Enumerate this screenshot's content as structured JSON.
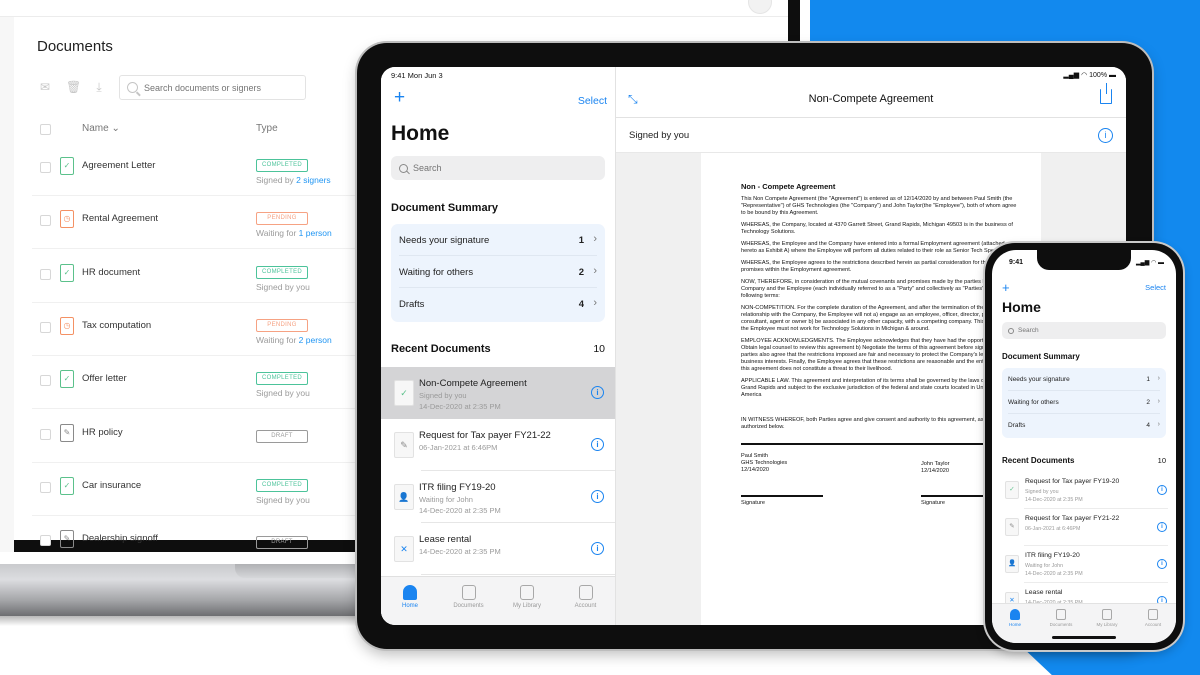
{
  "colors": {
    "brand_blue": "#1289ee",
    "accent_blue": "#1a84f0",
    "completed": "#4cc39a",
    "pending": "#f6a283",
    "draft": "#9a9a9a",
    "summary_bg": "#edf4fd"
  },
  "laptop": {
    "page_title": "Documents",
    "toolbar_icons": [
      "mail-icon",
      "trash-icon",
      "download-icon"
    ],
    "search": {
      "placeholder": "Search documents or signers",
      "value": ""
    },
    "columns": {
      "name": "Name",
      "type": "Type"
    },
    "rows": [
      {
        "name": "Agreement Letter",
        "status": "completed",
        "badge": "COMPLETED",
        "sub_prefix": "Signed by ",
        "sub_link": "2 signers"
      },
      {
        "name": "Rental Agreement",
        "status": "pending",
        "badge": "PENDING",
        "sub_prefix": "Waiting for ",
        "sub_link": "1 person"
      },
      {
        "name": "HR document",
        "status": "completed",
        "badge": "COMPLETED",
        "sub_prefix": "Signed by you",
        "sub_link": ""
      },
      {
        "name": "Tax computation",
        "status": "pending",
        "badge": "PENDING",
        "sub_prefix": "Waiting for ",
        "sub_link": "2 person"
      },
      {
        "name": "Offer letter",
        "status": "completed",
        "badge": "COMPLETED",
        "sub_prefix": "Signed by you",
        "sub_link": ""
      },
      {
        "name": "HR policy",
        "status": "draft",
        "badge": "DRAFT",
        "sub_prefix": "",
        "sub_link": ""
      },
      {
        "name": "Car insurance",
        "status": "completed",
        "badge": "COMPLETED",
        "sub_prefix": "Signed by you",
        "sub_link": ""
      },
      {
        "name": "Dealership signoff",
        "status": "draft",
        "badge": "DRAFT",
        "sub_prefix": "",
        "sub_link": ""
      }
    ]
  },
  "ipad": {
    "status_time": "9:41 Mon Jun 3",
    "status_right": "100%",
    "select_label": "Select",
    "home_title": "Home",
    "search_placeholder": "Search",
    "summary_title": "Document Summary",
    "summary": [
      {
        "label": "Needs your signature",
        "count": "1"
      },
      {
        "label": "Waiting for others",
        "count": "2"
      },
      {
        "label": "Drafts",
        "count": "4"
      }
    ],
    "recent_title": "Recent Documents",
    "recent_count": "10",
    "recent": [
      {
        "title": "Non-Compete Agreement",
        "line1": "Signed by you",
        "line2": "14-Dec-2020 at 2:35 PM",
        "icon": "check-icon",
        "selected": true
      },
      {
        "title": "Request for Tax payer FY21-22",
        "line1": "06-Jan-2021 at 6:46PM",
        "line2": "",
        "icon": "pencil-icon",
        "selected": false
      },
      {
        "title": "ITR filing FY19-20",
        "line1": "Waiting for John",
        "line2": "14-Dec-2020 at 2:35 PM",
        "icon": "person-icon",
        "selected": false
      },
      {
        "title": "Lease rental",
        "line1": "14-Dec-2020 at 2:35 PM",
        "line2": "",
        "icon": "signature-icon",
        "selected": false
      }
    ],
    "tabs": [
      {
        "label": "Home",
        "icon": "home-icon",
        "active": true
      },
      {
        "label": "Documents",
        "icon": "document-icon",
        "active": false
      },
      {
        "label": "My Library",
        "icon": "library-icon",
        "active": false
      },
      {
        "label": "Account",
        "icon": "account-icon",
        "active": false
      }
    ],
    "viewer": {
      "title": "Non-Compete Agreement",
      "signed_status": "Signed by you",
      "doc_heading": "Non - Compete Agreement",
      "paragraphs": [
        "This Non Compete Agreement (the \"Agreement\") is entered as of 12/14/2020 by and between Paul Smith  (the \"Representative\") of GHS Technologies (the \"Company\") and John Taylor(the \"Employee\"), both of whom agree to be bound by this Agreement.",
        "WHEREAS, the Company, located at 4370  Garrett Street, Grand Rapids, Michigan 49503 is in the business of Technology Solutions.",
        "WHEREAS, the Employee and the Company have entered into a formal Employment agreement (attached hereto as Exhibit A) where the Employee will perform all duties related to their role as Senior Tech Specialist.",
        "WHEREAS, the Employee agrees to the restrictions described herein as partial consideration for the Company's promises within the Employment agreement.",
        "NOW, THEREFORE, in consideration of the mutual covenants and promises made by the parties hereto, the Company and the Employee (each individually referred to as a \"Party\" and collectively as \"Parties\") agree to the following terms:",
        "NON-COMPETITION. For the complete duration of the Agreement, and after the termination of the Employee's relationship with the Company, the Employee will not a) engage as an employee, officer, director, partner, consultant, agent or owner b) be associated in any other capacity, with a competing company. This means that the Employee must not work for Technology Solutions in Michigan & around.",
        "EMPLOYEE ACKNOWLEDGMENTS. The Employee acknowledges that they have had the opportunity to a) Obtain legal counsel to review this agreement b) Negotiate the terms of this agreement before signing it. Both parties also agree that the restrictions imposed are fair and necessary to protect the Company's legitimate business interests. Finally, the Employee agrees that these restrictions are reasonable and the enforcement of this agreement does not constitute a threat to their livelihood.",
        "APPLICABLE LAW. This agreement and interpretation of its terms shall be governed by the laws of Michigan, Grand Rapids and subject to the exclusive jurisdiction of the federal and state courts located in United States of America",
        "IN WITNESS WHEREOF, both Parties agree and give consent and authority to this agreement, as duly authorized below."
      ],
      "party_left": {
        "name": "Paul Smith",
        "company": "GHS Technologies",
        "date": "12/14/2020"
      },
      "party_right": {
        "name": "John Taylor",
        "date": "12/14/2020"
      },
      "signature_label": "Signature"
    }
  },
  "iphone": {
    "status_time": "9:41",
    "select_label": "Select",
    "home_title": "Home",
    "search_placeholder": "Search",
    "summary_title": "Document Summary",
    "summary": [
      {
        "label": "Needs your signature",
        "count": "1"
      },
      {
        "label": "Waiting for others",
        "count": "2"
      },
      {
        "label": "Drafts",
        "count": "4"
      }
    ],
    "recent_title": "Recent Documents",
    "recent_count": "10",
    "recent": [
      {
        "title": "Request for Tax payer FY19-20",
        "line1": "Signed by you",
        "line2": "14-Dec-2020 at 2:35 PM",
        "icon": "check-icon"
      },
      {
        "title": "Request for Tax payer FY21-22",
        "line1": "06-Jan-2021 at 6:46PM",
        "line2": "",
        "icon": "pencil-icon"
      },
      {
        "title": "ITR filing FY19-20",
        "line1": "Waiting for John",
        "line2": "14-Dec-2020 at 2:35 PM",
        "icon": "person-icon"
      },
      {
        "title": "Lease rental",
        "line1": "14-Dec-2020 at 2:35 PM",
        "line2": "",
        "icon": "signature-icon"
      }
    ],
    "tabs": [
      {
        "label": "Home",
        "icon": "home-icon",
        "active": true
      },
      {
        "label": "Documents",
        "icon": "document-icon",
        "active": false
      },
      {
        "label": "My Library",
        "icon": "library-icon",
        "active": false
      },
      {
        "label": "Account",
        "icon": "account-icon",
        "active": false
      }
    ]
  }
}
